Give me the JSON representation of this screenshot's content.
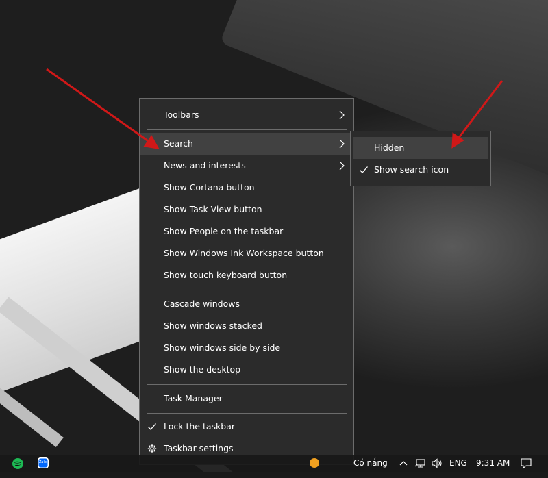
{
  "context_menu": {
    "items": [
      {
        "label": "Toolbars",
        "submenu": true
      },
      {
        "label": "Search",
        "submenu": true
      },
      {
        "label": "News and interests",
        "submenu": true
      },
      {
        "label": "Show Cortana button"
      },
      {
        "label": "Show Task View button"
      },
      {
        "label": "Show People on the taskbar"
      },
      {
        "label": "Show Windows Ink Workspace button"
      },
      {
        "label": "Show touch keyboard button"
      },
      {
        "label": "Cascade windows"
      },
      {
        "label": "Show windows stacked"
      },
      {
        "label": "Show windows side by side"
      },
      {
        "label": "Show the desktop"
      },
      {
        "label": "Task Manager"
      },
      {
        "label": "Lock the taskbar",
        "checked": true
      },
      {
        "label": "Taskbar settings",
        "icon": "gear-icon"
      }
    ]
  },
  "search_submenu": {
    "items": [
      {
        "label": "Hidden"
      },
      {
        "label": "Show search icon",
        "checked": true
      }
    ]
  },
  "taskbar": {
    "apps": [
      {
        "name": "Spotify",
        "icon": "spotify-icon",
        "color": "#1DB954"
      },
      {
        "name": "Zalo",
        "icon": "zalo-icon",
        "label": "Zalo",
        "color": "#0068FF"
      }
    ],
    "weather": "Có nắng",
    "language": "ENG",
    "time": "9:31 AM"
  },
  "colors": {
    "menu_bg": "#2b2b2b",
    "menu_border": "#6c6c6c",
    "hover_bg": "#414141",
    "annotation_arrow": "#d01818"
  }
}
